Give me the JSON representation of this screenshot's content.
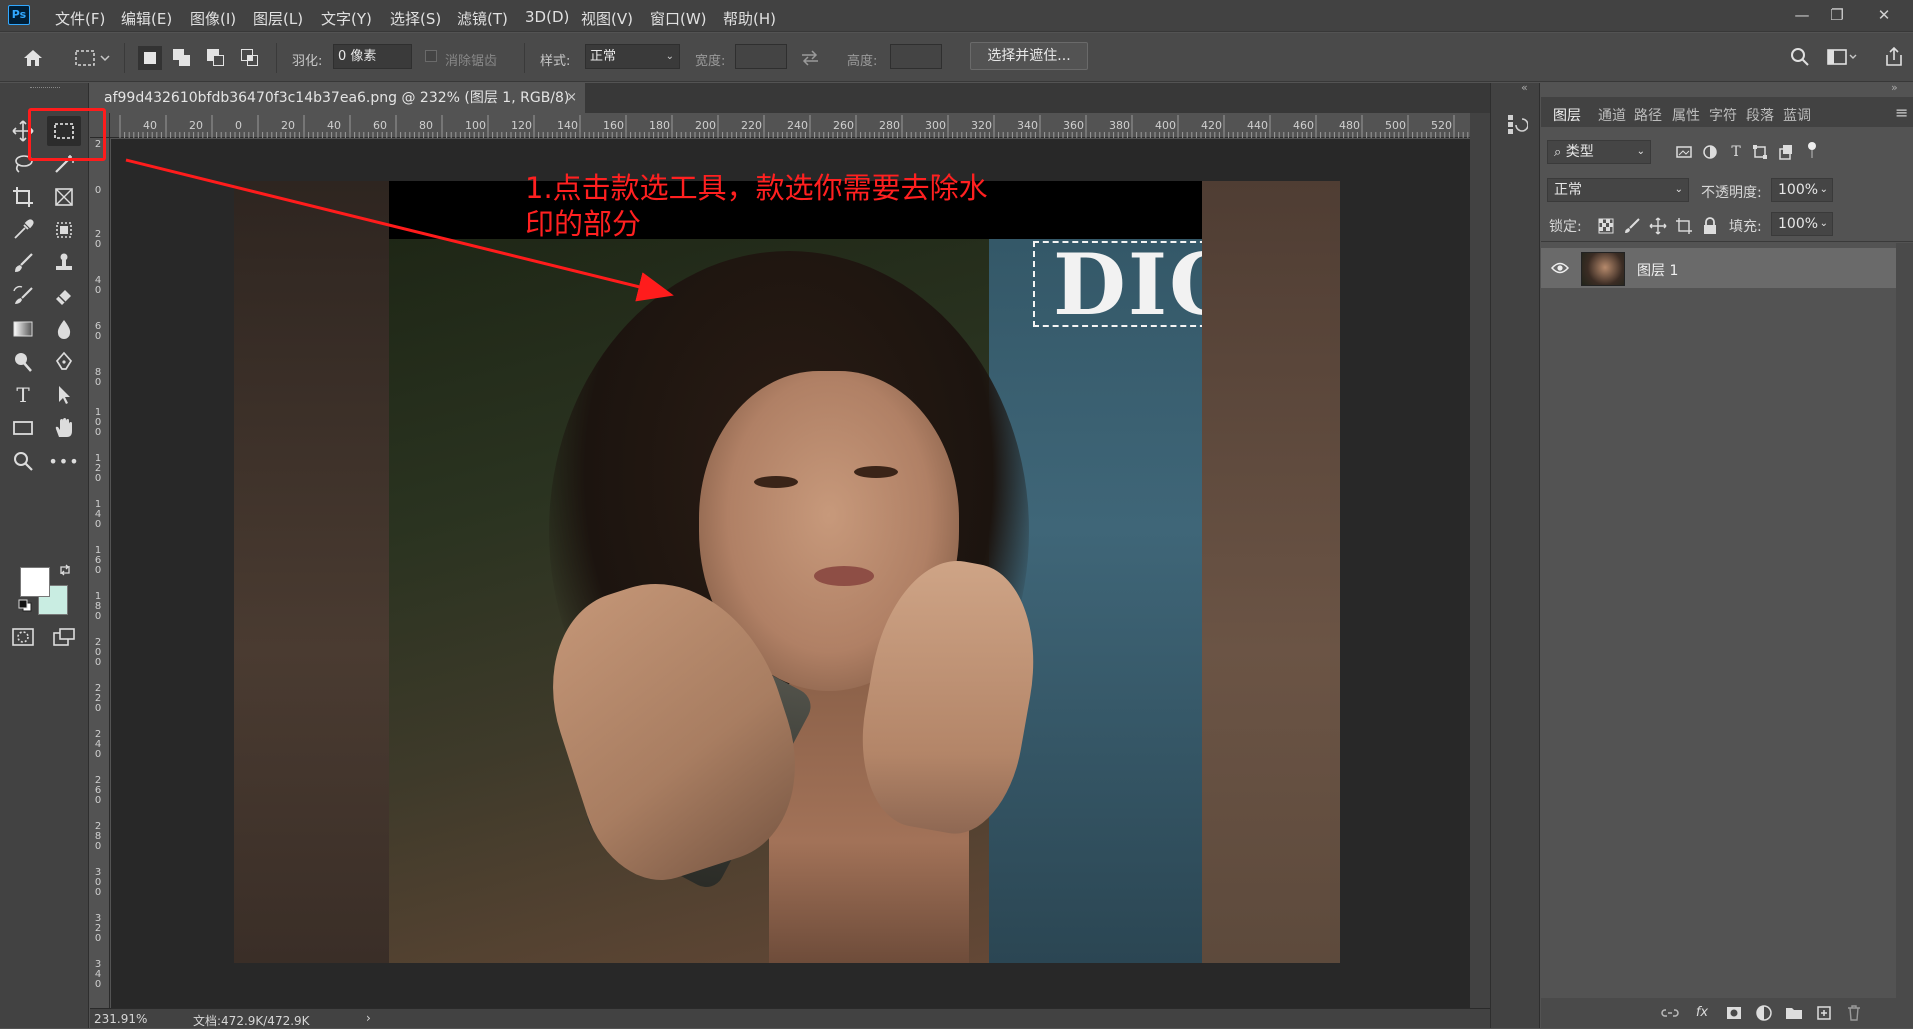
{
  "app": {
    "logo": "Ps"
  },
  "menu": [
    "文件(F)",
    "编辑(E)",
    "图像(I)",
    "图层(L)",
    "文字(Y)",
    "选择(S)",
    "滤镜(T)",
    "3D(D)",
    "视图(V)",
    "窗口(W)",
    "帮助(H)"
  ],
  "window_controls": {
    "minimize": "—",
    "restore": "❐",
    "close": "✕"
  },
  "options": {
    "feather_label": "羽化:",
    "feather_value": "0 像素",
    "antialias_label": "消除锯齿",
    "style_label": "样式:",
    "style_value": "正常",
    "width_label": "宽度:",
    "height_label": "高度:",
    "select_mask_button": "选择并遮住..."
  },
  "document": {
    "tab_title": "af99d432610bfdb36470f3c14b37ea6.png @ 232% (图层 1, RGB/8)",
    "tab_close": "×",
    "ruler_top": [
      "40",
      "20",
      "0",
      "20",
      "40",
      "60",
      "80",
      "100",
      "120",
      "140",
      "160",
      "180",
      "200",
      "220",
      "240",
      "260",
      "280",
      "300",
      "320",
      "340",
      "360",
      "380",
      "400",
      "420",
      "440",
      "460",
      "480",
      "500",
      "520"
    ],
    "ruler_left": [
      "2",
      "0",
      "2 0",
      "4 0",
      "6 0",
      "8 0",
      "1 0 0",
      "1 2 0",
      "1 4 0",
      "1 6 0",
      "1 8 0",
      "2 0 0",
      "2 2 0",
      "2 4 0",
      "2 6 0",
      "2 8 0",
      "3 0 0",
      "3 2 0",
      "3 4 0"
    ],
    "watermark_text": "DIO",
    "annotation": "1.点击款选工具，款选你需要去除水印的部分"
  },
  "status": {
    "zoom": "231.91%",
    "doc_size": "文档:472.9K/472.9K",
    "arrow": "›"
  },
  "layers_panel": {
    "tabs": [
      "图层",
      "通道",
      "路径",
      "属性",
      "字符",
      "段落",
      "蓝调"
    ],
    "filter_value": "类型",
    "blend_mode": "正常",
    "opacity_label": "不透明度:",
    "opacity_value": "100%",
    "lock_label": "锁定:",
    "fill_label": "填充:",
    "fill_value": "100%",
    "layer_name": "图层 1"
  },
  "colors": {
    "foreground": "#ffffff",
    "background": "#c9ede2",
    "annotation": "#ff2020",
    "highlight": "#ff1c1c"
  }
}
